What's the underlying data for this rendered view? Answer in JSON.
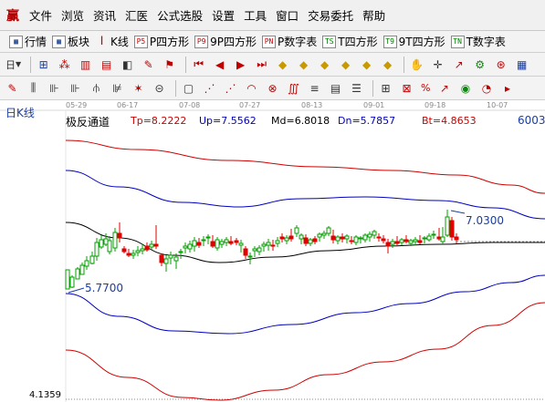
{
  "menu": {
    "logo": "赢",
    "items": [
      "文件",
      "浏览",
      "资讯",
      "汇医",
      "公式选股",
      "设置",
      "工具",
      "窗口",
      "交易委托",
      "帮助"
    ]
  },
  "toolbar1": {
    "items": [
      {
        "icon": "grid",
        "label": "行情"
      },
      {
        "icon": "grid",
        "label": "板块"
      },
      {
        "icon": "candle",
        "label": "K线"
      },
      {
        "icon": "P5",
        "label": "P四方形"
      },
      {
        "icon": "P9",
        "label": "9P四方形"
      },
      {
        "icon": "PN",
        "label": "P数字表"
      },
      {
        "icon": "T5",
        "label": "T四方形"
      },
      {
        "icon": "T9",
        "label": "9T四方形"
      },
      {
        "icon": "TN",
        "label": "T数字表"
      }
    ]
  },
  "toolbar2": {
    "period": "日"
  },
  "toolbar3": {
    "percent": "%"
  },
  "chart": {
    "period_label": "日K线",
    "indicator_name": "极反通道",
    "values": [
      {
        "label": "Tp=8.2222",
        "color": "#d00000"
      },
      {
        "label": "Up=7.5562",
        "color": "#0000c0"
      },
      {
        "label": "Md=6.8018",
        "color": "#000000"
      },
      {
        "label": "Dn=5.7857",
        "color": "#0000c0"
      },
      {
        "label": "Bt=4.8653",
        "color": "#d00000"
      }
    ],
    "code": "6003",
    "dates": [
      "05-29",
      "06-17",
      "07-08",
      "07-27",
      "08-13",
      "09-01",
      "09-18",
      "10-07"
    ],
    "high_annotation": "7.0300",
    "low_annotation": "5.7700",
    "bottom_price": "4.1359",
    "up_color": "#00a000",
    "down_color": "#e00000"
  }
}
